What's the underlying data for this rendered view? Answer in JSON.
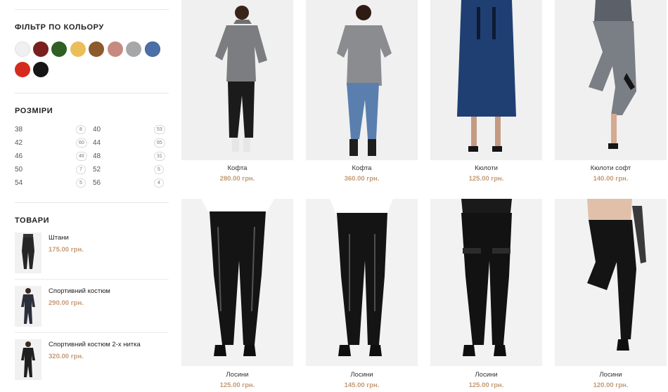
{
  "filters": {
    "color_title": "ФІЛЬТР ПО КОЛЬОРУ",
    "colors": [
      {
        "name": "white",
        "hex": "#f0f0f0"
      },
      {
        "name": "burgundy",
        "hex": "#7b1e1e"
      },
      {
        "name": "green",
        "hex": "#2f5f23"
      },
      {
        "name": "yellow",
        "hex": "#eabf5a"
      },
      {
        "name": "brown",
        "hex": "#8d5a2b"
      },
      {
        "name": "pink",
        "hex": "#c78a80"
      },
      {
        "name": "grey",
        "hex": "#a6a7a8"
      },
      {
        "name": "blue",
        "hex": "#4b6fa8"
      },
      {
        "name": "red",
        "hex": "#d52b1e"
      },
      {
        "name": "black",
        "hex": "#161616"
      }
    ],
    "sizes_title": "РОЗМІРИ",
    "sizes": [
      {
        "label": "38",
        "count": "8"
      },
      {
        "label": "40",
        "count": "53"
      },
      {
        "label": "42",
        "count": "60"
      },
      {
        "label": "44",
        "count": "65"
      },
      {
        "label": "46",
        "count": "46"
      },
      {
        "label": "48",
        "count": "31"
      },
      {
        "label": "50",
        "count": "7"
      },
      {
        "label": "52",
        "count": "5"
      },
      {
        "label": "54",
        "count": "5"
      },
      {
        "label": "56",
        "count": "4"
      }
    ]
  },
  "widget": {
    "title": "ТОВАРИ",
    "items": [
      {
        "name": "Штани",
        "price": "175.00 грн."
      },
      {
        "name": "Спортивний костюм",
        "price": "290.00 грн."
      },
      {
        "name": "Спортивний костюм 2-х нитка",
        "price": "320.00 грн."
      }
    ]
  },
  "products": [
    {
      "name": "Кофта",
      "price": "280.00 грн."
    },
    {
      "name": "Кофта",
      "price": "360.00 грн."
    },
    {
      "name": "Кюлоти",
      "price": "125.00 грн."
    },
    {
      "name": "Кюлоти софт",
      "price": "140.00 грн."
    },
    {
      "name": "Лосини",
      "price": "125.00 грн."
    },
    {
      "name": "Лосини",
      "price": "145.00 грн."
    },
    {
      "name": "Лосини",
      "price": "125.00 грн."
    },
    {
      "name": "Лосини",
      "price": "120.00 грн."
    }
  ]
}
